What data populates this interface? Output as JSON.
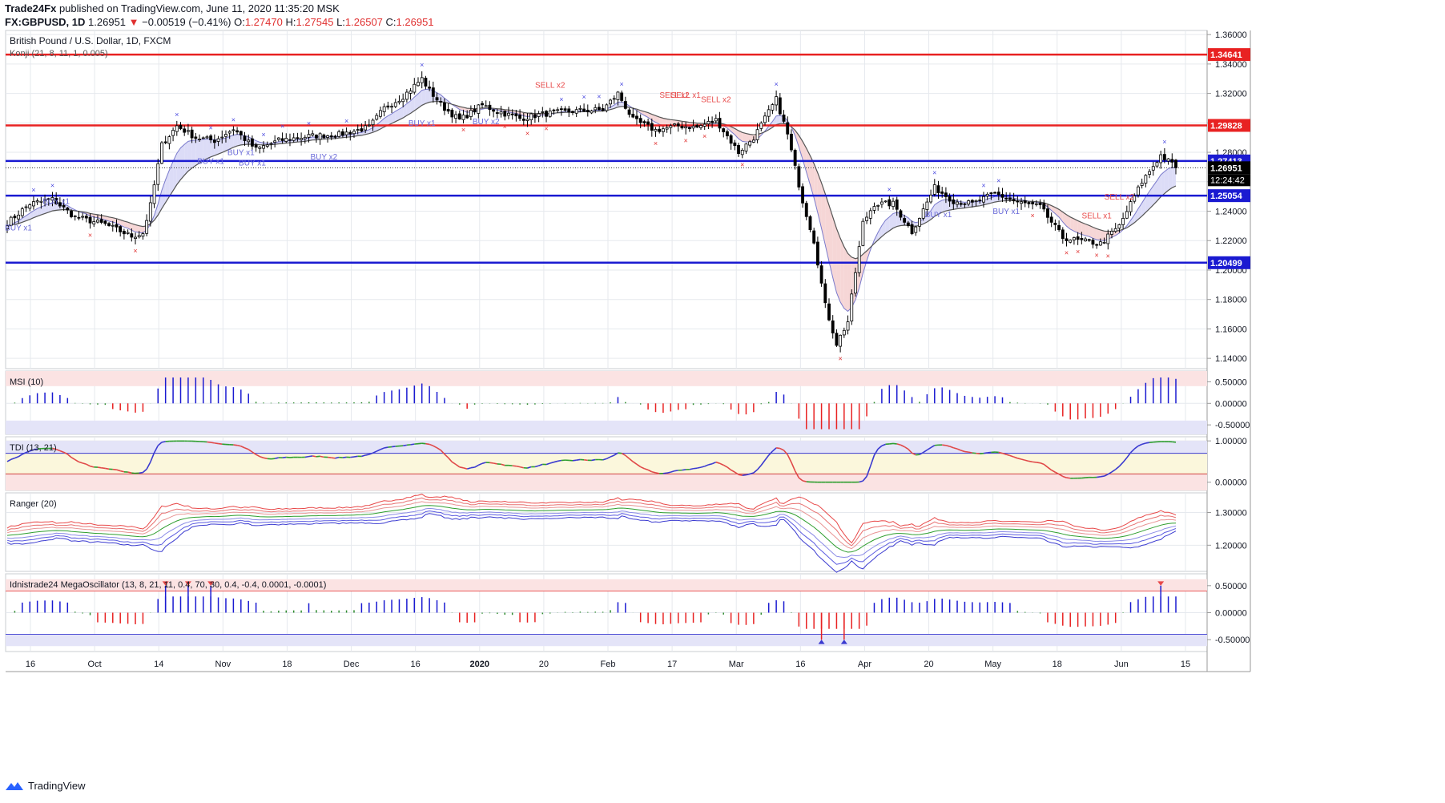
{
  "header": {
    "publisher": "Trade24Fx",
    "published_text": "published on TradingView.com, June 11, 2020 11:35:20 MSK",
    "symbol": "FX:GBPUSD, 1D",
    "last": "1.26951",
    "change": "−0.00519 (−0.41%)",
    "o_label": "O:",
    "o": "1.27470",
    "h_label": "H:",
    "h": "1.27545",
    "l_label": "L:",
    "l": "1.26507",
    "c_label": "C:",
    "c": "1.26951"
  },
  "footer": {
    "brand": "TradingView",
    "logo_icon": "tradingview-logo-icon"
  },
  "chart_data": [
    {
      "type": "candlestick",
      "title": "British Pound / U.S. Dollar, 1D, FXCM",
      "subtitle": "Konji (21, 8, 11, 1, 0.005)",
      "y_ticks": [
        "1.36000",
        "1.34000",
        "1.32000",
        "1.30000",
        "1.28000",
        "1.26000",
        "1.24000",
        "1.22000",
        "1.20000",
        "1.18000",
        "1.16000",
        "1.14000"
      ],
      "ylim": [
        1.133,
        1.3628
      ],
      "x_ticks": [
        "16",
        "Oct",
        "14",
        "Nov",
        "18",
        "Dec",
        "16",
        "2020",
        "20",
        "Feb",
        "17",
        "Mar",
        "16",
        "Apr",
        "20",
        "May",
        "18",
        "Jun",
        "15"
      ],
      "horizontal_levels": [
        {
          "value": 1.34641,
          "label": "1.34641",
          "color": "#e82222"
        },
        {
          "value": 1.29828,
          "label": "1.29828",
          "color": "#e82222"
        },
        {
          "value": 1.27413,
          "label": "1.27413",
          "color": "#1a1ad1"
        },
        {
          "value": 1.25054,
          "label": "1.25054",
          "color": "#1a1ad1"
        },
        {
          "value": 1.20499,
          "label": "1.20499",
          "color": "#1a1ad1"
        }
      ],
      "last_price": {
        "value": 1.26951,
        "label": "1.26951",
        "countdown": "12:24:42"
      },
      "signals": [
        {
          "text": "BUY x1",
          "x_index": 3,
          "price": 1.227,
          "color": "#6a6ad9"
        },
        {
          "text": "BUY x1",
          "x_index": 13,
          "price": 1.245,
          "color": "#6a6ad9"
        },
        {
          "text": "BUY x1",
          "x_index": 54,
          "price": 1.272,
          "color": "#6a6ad9"
        },
        {
          "text": "BUY x1",
          "x_index": 62,
          "price": 1.278,
          "color": "#6a6ad9"
        },
        {
          "text": "BUY x1",
          "x_index": 65,
          "price": 1.271,
          "color": "#6a6ad9"
        },
        {
          "text": "BUY x2",
          "x_index": 84,
          "price": 1.275,
          "color": "#6a6ad9"
        },
        {
          "text": "BUY x1",
          "x_index": 110,
          "price": 1.298,
          "color": "#6a6ad9"
        },
        {
          "text": "BUY x2",
          "x_index": 127,
          "price": 1.299,
          "color": "#6a6ad9"
        },
        {
          "text": "SELL x2",
          "x_index": 144,
          "price": 1.324,
          "color": "#e84c4c"
        },
        {
          "text": "SELL x2",
          "x_index": 177,
          "price": 1.317,
          "color": "#e84c4c"
        },
        {
          "text": "SELL x1",
          "x_index": 180,
          "price": 1.317,
          "color": "#e84c4c"
        },
        {
          "text": "SELL x2",
          "x_index": 188,
          "price": 1.314,
          "color": "#e84c4c"
        },
        {
          "text": "BUY x1",
          "x_index": 247,
          "price": 1.236,
          "color": "#6a6ad9"
        },
        {
          "text": "BUY x1",
          "x_index": 265,
          "price": 1.238,
          "color": "#6a6ad9"
        },
        {
          "text": "SELL x1",
          "x_index": 289,
          "price": 1.235,
          "color": "#e84c4c"
        },
        {
          "text": "SELL x2",
          "x_index": 295,
          "price": 1.248,
          "color": "#e84c4c"
        }
      ],
      "anchors": [
        [
          0,
          1.232
        ],
        [
          6,
          1.245
        ],
        [
          12,
          1.248
        ],
        [
          18,
          1.236
        ],
        [
          26,
          1.231
        ],
        [
          33,
          1.223
        ],
        [
          36,
          1.225
        ],
        [
          38,
          1.244
        ],
        [
          41,
          1.285
        ],
        [
          45,
          1.298
        ],
        [
          50,
          1.29
        ],
        [
          55,
          1.288
        ],
        [
          60,
          1.296
        ],
        [
          66,
          1.282
        ],
        [
          72,
          1.288
        ],
        [
          80,
          1.291
        ],
        [
          88,
          1.292
        ],
        [
          96,
          1.297
        ],
        [
          100,
          1.31
        ],
        [
          105,
          1.318
        ],
        [
          110,
          1.33
        ],
        [
          112,
          1.322
        ],
        [
          116,
          1.31
        ],
        [
          120,
          1.302
        ],
        [
          126,
          1.312
        ],
        [
          130,
          1.308
        ],
        [
          136,
          1.303
        ],
        [
          142,
          1.306
        ],
        [
          150,
          1.308
        ],
        [
          158,
          1.309
        ],
        [
          162,
          1.32
        ],
        [
          166,
          1.302
        ],
        [
          172,
          1.295
        ],
        [
          178,
          1.298
        ],
        [
          183,
          1.297
        ],
        [
          188,
          1.302
        ],
        [
          194,
          1.28
        ],
        [
          198,
          1.29
        ],
        [
          204,
          1.316
        ],
        [
          207,
          1.292
        ],
        [
          211,
          1.247
        ],
        [
          214,
          1.22
        ],
        [
          217,
          1.176
        ],
        [
          220,
          1.15
        ],
        [
          223,
          1.165
        ],
        [
          227,
          1.232
        ],
        [
          230,
          1.245
        ],
        [
          235,
          1.245
        ],
        [
          240,
          1.226
        ],
        [
          246,
          1.256
        ],
        [
          251,
          1.247
        ],
        [
          256,
          1.245
        ],
        [
          262,
          1.252
        ],
        [
          268,
          1.246
        ],
        [
          274,
          1.243
        ],
        [
          280,
          1.222
        ],
        [
          284,
          1.22
        ],
        [
          290,
          1.218
        ],
        [
          295,
          1.23
        ],
        [
          301,
          1.26
        ],
        [
          306,
          1.278
        ],
        [
          310,
          1.27
        ]
      ],
      "n_bars": 311
    },
    {
      "type": "bar",
      "title": "MSI (10)",
      "y_ticks": [
        "0.50000",
        "0.00000",
        "-0.50000"
      ],
      "ylim": [
        -0.72,
        0.75
      ],
      "bands": [
        0.4,
        -0.4
      ]
    },
    {
      "type": "line",
      "title": "TDI (13, 21)",
      "y_ticks": [
        "1.00000",
        "0.00000"
      ],
      "ylim": [
        -0.2,
        1.1
      ],
      "bands": [
        0.7,
        0.2
      ]
    },
    {
      "type": "line",
      "title": "Ranger (20)",
      "y_ticks": [
        "1.30000",
        "1.20000"
      ],
      "ylim": [
        1.12,
        1.36
      ]
    },
    {
      "type": "bar",
      "title": "Idnistrade24 MegaOscillator (13, 8, 21, 11, 0.4, 70, 30, 0.4, -0.4, 0.0001, -0.0001)",
      "y_ticks": [
        "0.50000",
        "0.00000",
        "-0.50000"
      ],
      "ylim": [
        -0.72,
        0.72
      ],
      "bands": [
        0.4,
        -0.4
      ]
    }
  ],
  "colors": {
    "bull": "#ffffff",
    "bear": "#000000",
    "blue": "#1a1ad1",
    "red": "#e82222",
    "green": "#2e8b2e",
    "grid": "#e6e9ee",
    "axis": "#9a9a9a"
  }
}
